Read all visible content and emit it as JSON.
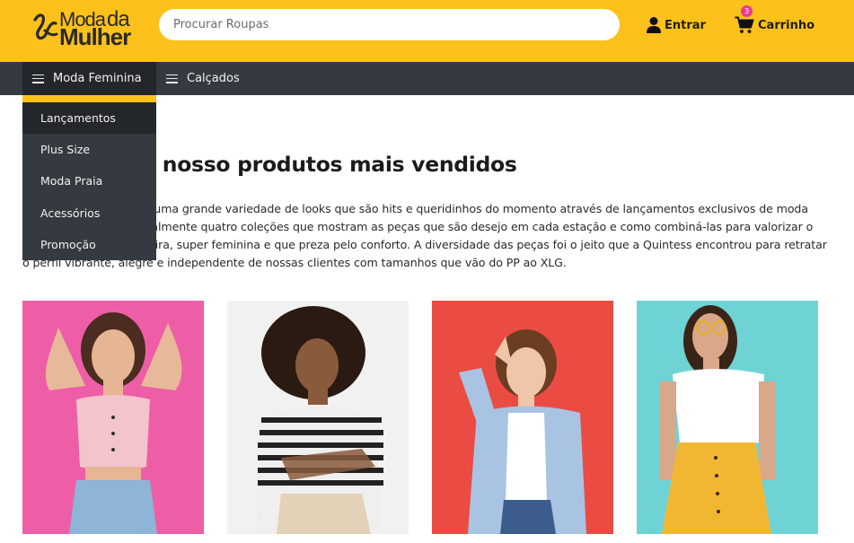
{
  "brand": {
    "line1": "Moda",
    "line1b": "da",
    "line2": "Mulher",
    "logo_icon": "wave-logo-icon",
    "color": "#fcc11a"
  },
  "header": {
    "search_placeholder": "Procurar Roupas",
    "login_label": "Entrar",
    "login_icon": "user-icon",
    "cart_label": "Carrinho",
    "cart_icon": "cart-icon",
    "cart_count": "3"
  },
  "nav": {
    "items": [
      {
        "label": "Moda Feminina",
        "icon": "menu-icon"
      },
      {
        "label": "Calçados",
        "icon": "menu-icon"
      }
    ]
  },
  "dropdown": {
    "items": [
      {
        "label": "Lançamentos"
      },
      {
        "label": "Plus Size"
      },
      {
        "label": "Moda Praia"
      },
      {
        "label": "Acessórios"
      },
      {
        "label": "Promoção"
      }
    ]
  },
  "main": {
    "title": "Conheça os nosso produtos mais vendidos",
    "description": "Na Quintess utilizamos uma grande variedade de looks que são hits e queridinhos do momento através de lançamentos exclusivos de moda feminina. Fazemos anualmente quatro coleções que mostram as peças que são desejo em cada estação e como combiná-las para valorizar o corpo da mulher brasileira, super feminina e que preza pelo conforto. A diversidade das peças foi o jeito que a Quintess encontrou para retratar o perfil vibrante, alegre e independente de nossas clientes com tamanhos que vão do PP ao XLG."
  },
  "products": [
    {
      "bg": "#ee5ea7"
    },
    {
      "bg": "#f1f1f1"
    },
    {
      "bg": "#ea4c44"
    },
    {
      "bg": "#6fd3d6"
    }
  ]
}
